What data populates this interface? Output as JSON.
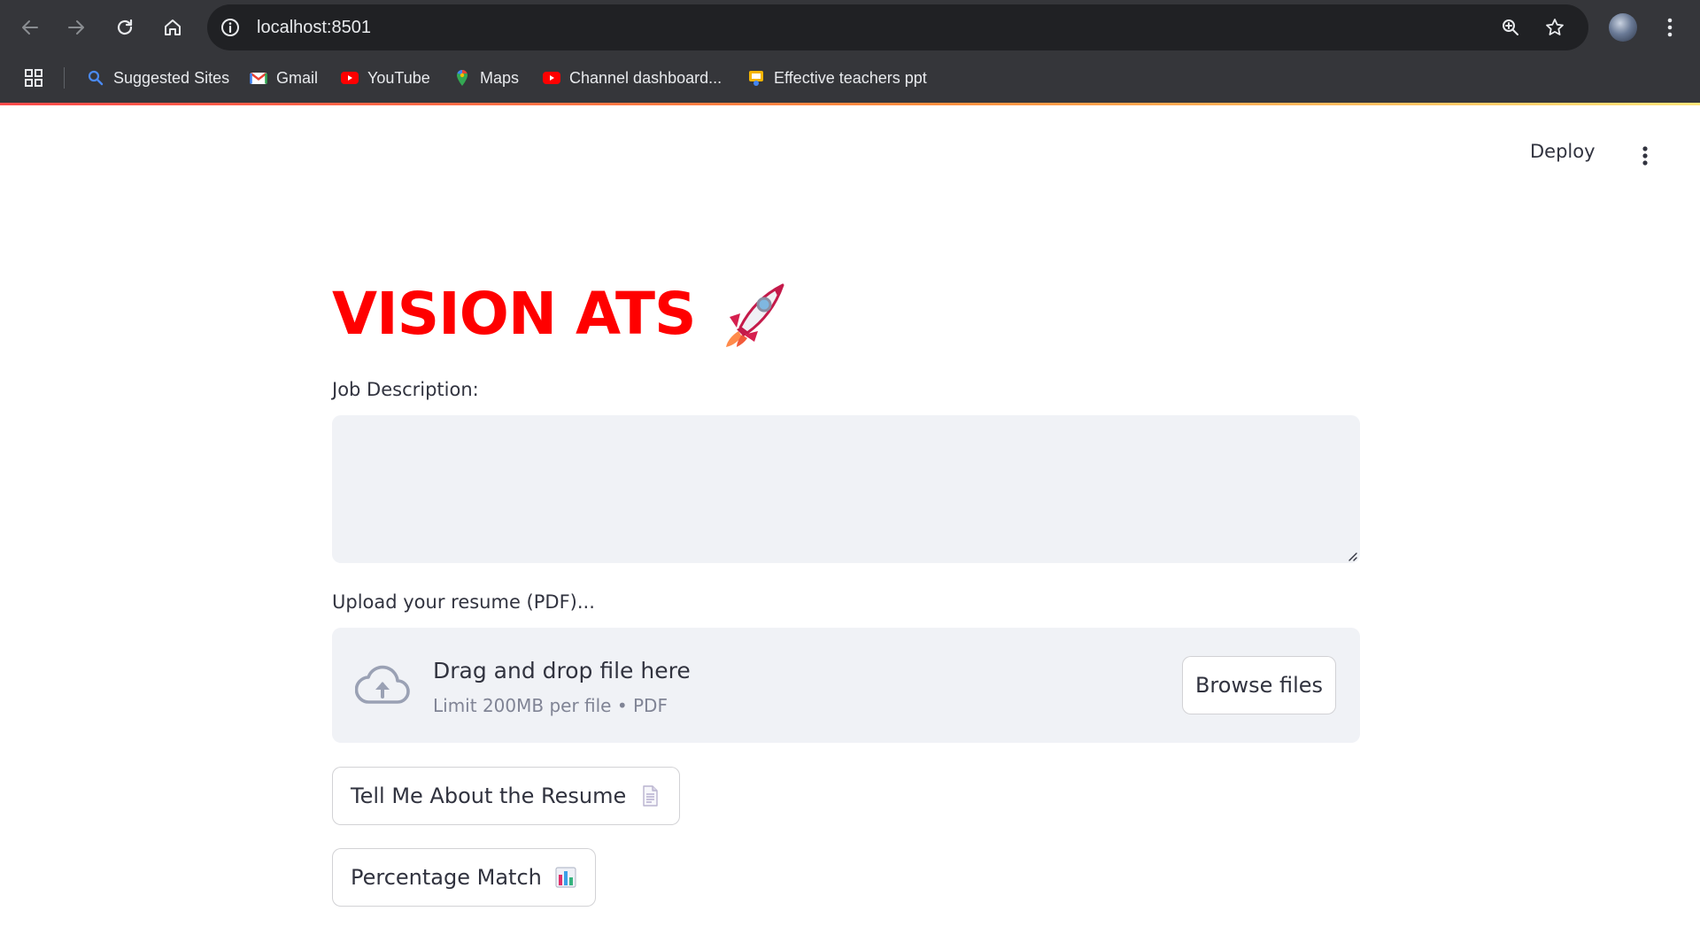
{
  "browser": {
    "url": "localhost:8501",
    "bookmarks": [
      {
        "label": "Suggested Sites",
        "icon": "search-icon"
      },
      {
        "label": "Gmail",
        "icon": "gmail-icon"
      },
      {
        "label": "YouTube",
        "icon": "youtube-icon"
      },
      {
        "label": "Maps",
        "icon": "maps-icon"
      },
      {
        "label": "Channel dashboard...",
        "icon": "youtube-icon"
      },
      {
        "label": "Effective teachers ppt",
        "icon": "slides-icon"
      }
    ]
  },
  "header": {
    "deploy_label": "Deploy"
  },
  "main": {
    "title": "VISION ATS",
    "title_color": "#ff0000",
    "job_description_label": "Job Description:",
    "job_description_value": "",
    "upload_label": "Upload your resume (PDF)...",
    "uploader": {
      "title": "Drag and drop file here",
      "subtitle": "Limit 200MB per file • PDF",
      "browse_label": "Browse files"
    },
    "buttons": {
      "tell_me_label": "Tell Me About the Resume",
      "percentage_label": "Percentage Match"
    }
  },
  "colors": {
    "chrome_bg": "#35363a",
    "omnibox_bg": "#202124",
    "input_bg": "#f0f2f6",
    "text": "#31333f"
  }
}
